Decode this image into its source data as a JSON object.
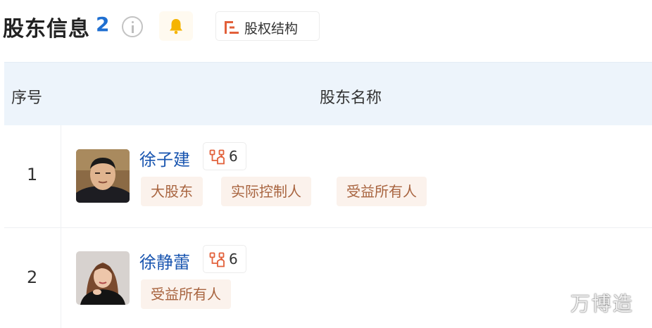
{
  "header": {
    "title": "股东信息",
    "count": "2",
    "equity_structure_label": "股权结构"
  },
  "table": {
    "columns": {
      "index": "序号",
      "name": "股东名称"
    },
    "rows": [
      {
        "index": "1",
        "name": "徐子建",
        "relation_count": "6",
        "tags": [
          "大股东",
          "实际控制人",
          "受益所有人"
        ]
      },
      {
        "index": "2",
        "name": "徐静蕾",
        "relation_count": "6",
        "tags": [
          "受益所有人"
        ]
      }
    ]
  },
  "watermark": "万博造",
  "colors": {
    "name_link": "#1a56b0",
    "count_accent": "#1f6fd1",
    "tag_bg": "#fbf2ec",
    "tag_text": "#a8643f",
    "header_bg": "#edf4fb",
    "bell": "#f5b400",
    "relation_icon": "#e2603a"
  },
  "icons": {
    "info": "info-icon",
    "bell": "bell-icon",
    "equity": "equity-structure-icon",
    "relation": "relation-graph-icon"
  }
}
